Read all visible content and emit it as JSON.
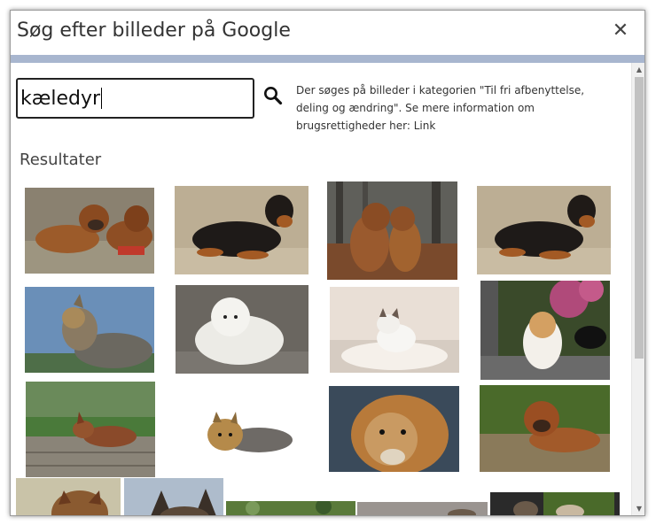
{
  "dialog": {
    "title": "Søg efter billeder på Google",
    "close_symbol": "✕",
    "title_stripe_color": "#a8b6cf"
  },
  "search": {
    "value": "kæledyr",
    "button_icon": "search-icon"
  },
  "info": {
    "text": "Der søges på billeder i kategorien \"Til fri afbenyttelse, deling og ændring\". Se mere information om brugsrettigheder her: ",
    "link_label": "Link"
  },
  "results": {
    "heading": "Resultater",
    "images": [
      {
        "subject": "two brown mastiffs lying on gravel"
      },
      {
        "subject": "black and tan dachshund lying on sand"
      },
      {
        "subject": "two brown mastiffs sitting in autumn forest"
      },
      {
        "subject": "black and tan dachshund lying on sand"
      },
      {
        "subject": "yorkshire terrier under blue sky"
      },
      {
        "subject": "white samoyed lying on floor"
      },
      {
        "subject": "white kitten on fluffy blanket"
      },
      {
        "subject": "white and tan dog next to mirror"
      },
      {
        "subject": "brown dog lying on wooden deck"
      },
      {
        "subject": "yorkshire terrier lying on white background"
      },
      {
        "subject": "golden retriever close-up"
      },
      {
        "subject": "brown mastiff lying on grass"
      },
      {
        "subject": "fox in grass"
      },
      {
        "subject": "german shepherd ears"
      },
      {
        "subject": "garden and plants"
      },
      {
        "subject": "dog on grey background"
      },
      {
        "subject": "small dog on grass"
      }
    ]
  },
  "scrollbar": {
    "up_arrow": "▲",
    "down_arrow": "▼"
  }
}
